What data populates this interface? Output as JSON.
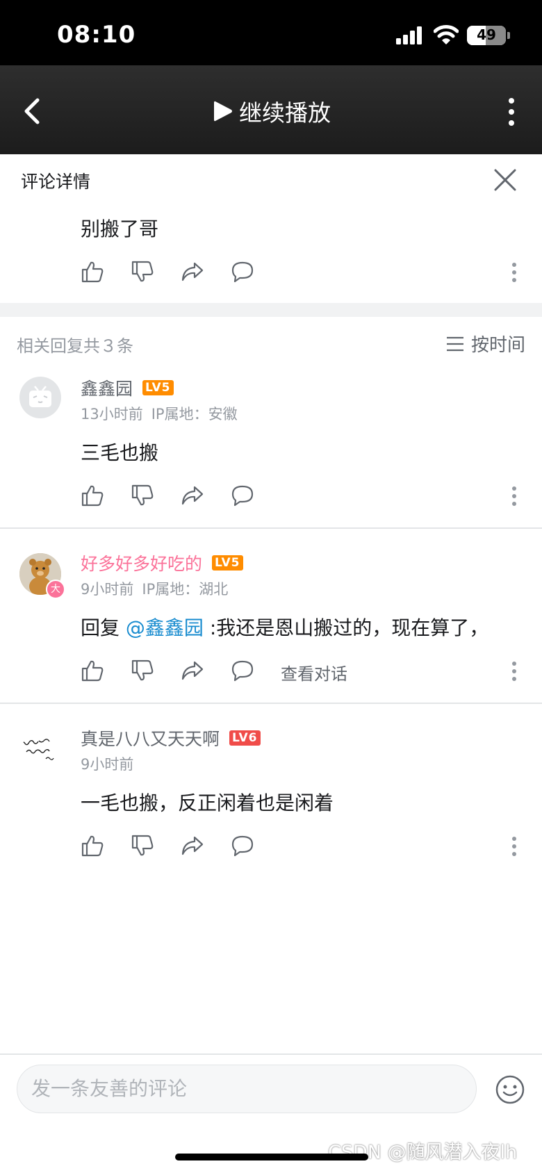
{
  "status_bar": {
    "time": "08:10",
    "battery": "49",
    "battery_level": 0.49
  },
  "header": {
    "continue_label": "继续播放"
  },
  "detail": {
    "title": "评论详情",
    "main_comment": "别搬了哥"
  },
  "replies": {
    "count_label": "相关回复共３条",
    "sort_label": "按时间",
    "items": [
      {
        "username": "鑫鑫园",
        "username_color": "#61666d",
        "level": "LV5",
        "level_color": "#ff8c00",
        "time": "13小时前",
        "ip": "IP属地：安徽",
        "text": "三毛也搬"
      },
      {
        "username": "好多好多好吃的",
        "username_color": "#fb7299",
        "level": "LV5",
        "level_color": "#ff8c00",
        "badge": "大",
        "time": "9小时前",
        "ip": "IP属地：湖北",
        "reply_prefix": "回复",
        "mention": "@鑫鑫园",
        "text": ":我还是恩山搬过的，现在算了，",
        "view_convo": "查看对话"
      },
      {
        "username": "真是八八又天天啊",
        "username_color": "#61666d",
        "level": "LV6",
        "level_color": "#f04c49",
        "time": "9小时前",
        "text": "一毛也搬，反正闲着也是闲着"
      }
    ]
  },
  "bottom": {
    "input_placeholder": "发一条友善的评论",
    "watermark": "CSDN @随风潜入夜lh"
  },
  "colors": {
    "accent_pink": "#fb7299",
    "link_blue": "#178bcf",
    "muted": "#9499a0"
  }
}
